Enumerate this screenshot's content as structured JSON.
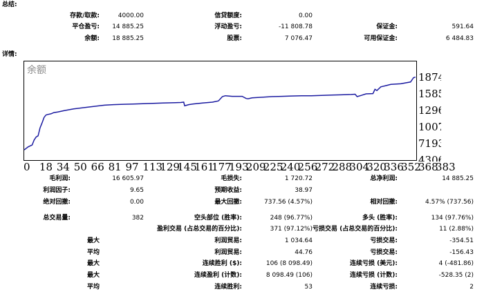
{
  "summary": {
    "heading": "总结:",
    "deposit_label": "存款/取款:",
    "deposit_value": "4000.00",
    "credit_label": "信贷额度:",
    "credit_value": "0.00",
    "closed_pl_label": "平仓盈亏:",
    "closed_pl_value": "14 885.25",
    "floating_pl_label": "浮动盈亏:",
    "floating_pl_value": "-11 808.78",
    "margin_label": "保证金:",
    "margin_value": "591.64",
    "balance_label": "余额:",
    "balance_value": "18 885.25",
    "equity_label": "股票:",
    "equity_value": "7 076.47",
    "free_margin_label": "可用保证金:",
    "free_margin_value": "6 484.83"
  },
  "details": {
    "heading": "详情:"
  },
  "chart_data": {
    "type": "line",
    "title": "余额",
    "y_ticks": [
      "1874",
      "1585",
      "1296",
      "1007",
      "7193",
      "4306"
    ],
    "x_ticks": [
      "0",
      "18",
      "34",
      "50",
      "66",
      "81",
      "97",
      "113",
      "129",
      "145",
      "161",
      "177",
      "193",
      "209",
      "225",
      "240",
      "256",
      "272",
      "288",
      "304",
      "320",
      "336",
      "352",
      "368",
      "383"
    ],
    "ylim": [
      4306,
      18740
    ],
    "xlim": [
      0,
      395
    ],
    "x": [
      0,
      4,
      8,
      10,
      12,
      14,
      16,
      18,
      20,
      22,
      24,
      27,
      30,
      34,
      40,
      50,
      60,
      70,
      81,
      90,
      100,
      110,
      120,
      130,
      140,
      150,
      158,
      161,
      162,
      163,
      166,
      170,
      180,
      190,
      196,
      200,
      203,
      206,
      210,
      215,
      220,
      224,
      226,
      230,
      240,
      250,
      260,
      270,
      280,
      290,
      300,
      310,
      320,
      330,
      334,
      336,
      340,
      345,
      352,
      354,
      356,
      360,
      365,
      370,
      380,
      390,
      393,
      395
    ],
    "y": [
      5300,
      5800,
      6100,
      6900,
      7400,
      7600,
      8900,
      9700,
      10600,
      11000,
      11100,
      11200,
      11400,
      11500,
      11700,
      12000,
      12200,
      12400,
      12600,
      12700,
      12750,
      12800,
      12850,
      12900,
      12950,
      13000,
      13050,
      13100,
      12500,
      12550,
      12700,
      12800,
      12950,
      13100,
      13300,
      14000,
      14150,
      14100,
      14050,
      14050,
      14050,
      13700,
      13650,
      13800,
      13900,
      14000,
      14050,
      14100,
      14150,
      14150,
      14200,
      14250,
      14300,
      14350,
      14400,
      14000,
      14200,
      14450,
      14500,
      15200,
      15000,
      15600,
      15800,
      16000,
      16100,
      16400,
      17100,
      17200
    ]
  },
  "stats": {
    "gross_profit_label": "毛利润:",
    "gross_profit_value": "16 605.97",
    "gross_loss_label": "毛损失:",
    "gross_loss_value": "1 720.72",
    "net_profit_label": "总净利润:",
    "net_profit_value": "14 885.25",
    "profit_factor_label": "利润因子:",
    "profit_factor_value": "9.65",
    "expected_payoff_label": "预期收益:",
    "expected_payoff_value": "38.97",
    "abs_drawdown_label": "绝对回撤:",
    "abs_drawdown_value": "0.00",
    "max_drawdown_label": "最大回撤:",
    "max_drawdown_value": "737.56 (4.57%)",
    "rel_drawdown_label": "相对回撤:",
    "rel_drawdown_value": "4.57% (737.56)",
    "total_trades_label": "总交易量:",
    "total_trades_value": "382",
    "short_label": "空头部位 (胜率):",
    "short_value": "248 (96.77%)",
    "long_label": "多头 (胜率):",
    "long_value": "134 (97.76%)",
    "profit_trades_label": "盈利交易 (占总交易的百分比):",
    "profit_trades_value": "371 (97.12%)",
    "loss_trades_label": "亏损交易 (占总交易的百分比):",
    "loss_trades_value": "11 (2.88%)",
    "max1_label": "最大",
    "largest_profit_label": "利润贸易:",
    "largest_profit_value": "1 034.64",
    "largest_loss_label": "亏损交易:",
    "largest_loss_value": "-354.51",
    "avg1_label": "平均",
    "avg_profit_label": "利润贸易:",
    "avg_profit_value": "44.76",
    "avg_loss_label": "亏损交易:",
    "avg_loss_value": "-156.43",
    "max2_label": "最大",
    "max_consec_wins_label": "连续胜利 ($):",
    "max_consec_wins_value": "106 (8 098.49)",
    "max_consec_losses_label": "连续亏损 (美元):",
    "max_consec_losses_value": "4 (-481.86)",
    "max3_label": "最大",
    "max_consec_profit_label": "连续盈利 (计数):",
    "max_consec_profit_value": "8 098.49 (106)",
    "max_consec_loss_label": "连续亏损 (计数):",
    "max_consec_loss_value": "-528.35 (2)",
    "avg2_label": "平均",
    "avg_consec_wins_label": "连续胜利:",
    "avg_consec_wins_value": "53",
    "avg_consec_losses_label": "连续亏损:",
    "avg_consec_losses_value": "2"
  }
}
